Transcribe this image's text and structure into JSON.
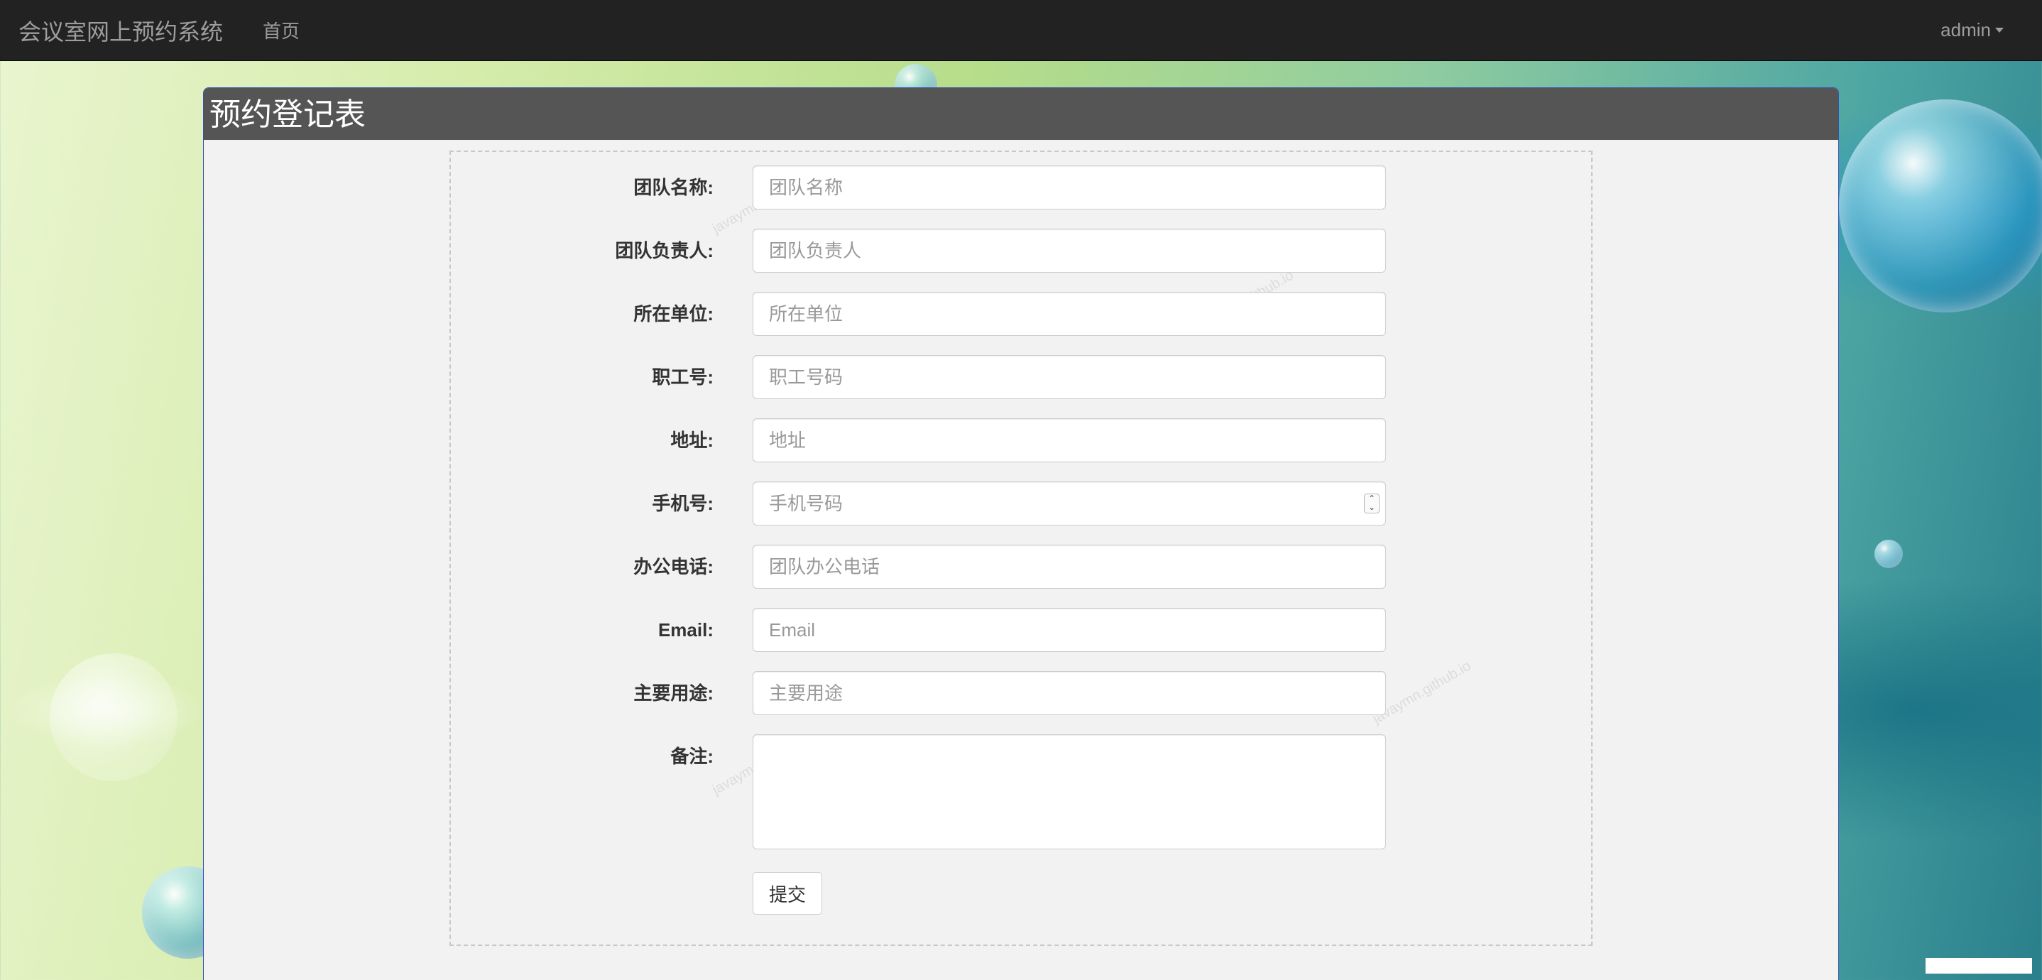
{
  "navbar": {
    "brand": "会议室网上预约系统",
    "home": "首页",
    "user": "admin"
  },
  "panel": {
    "title": "预约登记表"
  },
  "form": {
    "fields": [
      {
        "label": "团队名称:",
        "placeholder": "团队名称",
        "value": ""
      },
      {
        "label": "团队负责人:",
        "placeholder": "团队负责人",
        "value": ""
      },
      {
        "label": "所在单位:",
        "placeholder": "所在单位",
        "value": ""
      },
      {
        "label": "职工号:",
        "placeholder": "职工号码",
        "value": ""
      },
      {
        "label": "地址:",
        "placeholder": "地址",
        "value": ""
      },
      {
        "label": "手机号:",
        "placeholder": "手机号码",
        "value": ""
      },
      {
        "label": "办公电话:",
        "placeholder": "团队办公电话",
        "value": ""
      },
      {
        "label": "Email:",
        "placeholder": "Email",
        "value": ""
      },
      {
        "label": "主要用途:",
        "placeholder": "主要用途",
        "value": ""
      },
      {
        "label": "备注:",
        "placeholder": "",
        "value": ""
      }
    ],
    "submit_label": "提交"
  },
  "watermark": "javaymn.github.io",
  "colors": {
    "navbar_bg": "#222222",
    "navbar_text": "#9d9d9d",
    "panel_heading_bg": "#555555",
    "panel_bg": "#f2f2f2"
  }
}
